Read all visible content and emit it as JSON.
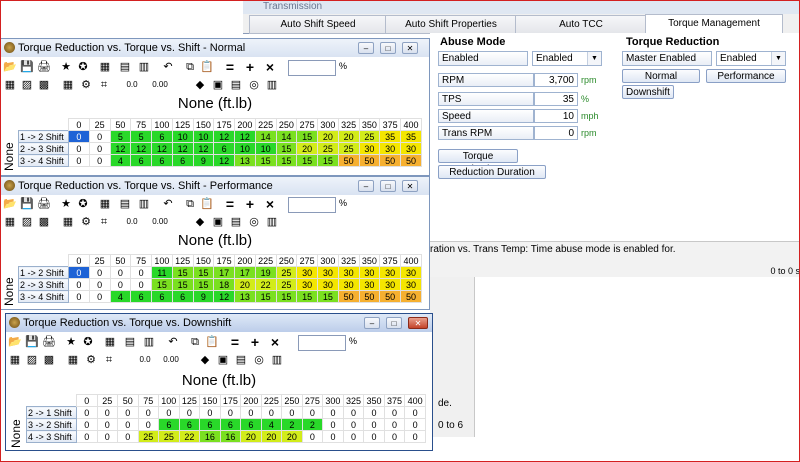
{
  "background": {
    "window_title": "Transmission",
    "tabs": [
      "Auto Shift Speed",
      "Auto Shift Properties",
      "Auto TCC",
      "Torque Management"
    ],
    "active_tab": "Torque Management",
    "abuse": {
      "heading": "Abuse Mode",
      "mode_label": "Enabled",
      "mode_value": "Enabled",
      "fields": [
        {
          "label": "RPM",
          "value": "3,700",
          "unit": "rpm"
        },
        {
          "label": "TPS",
          "value": "35",
          "unit": "%"
        },
        {
          "label": "Speed",
          "value": "10",
          "unit": "mph"
        },
        {
          "label": "Trans RPM",
          "value": "0",
          "unit": "rpm"
        }
      ],
      "btn_torque_reduction": "Torque Reduction",
      "btn_reduction_duration": "Reduction Duration"
    },
    "torque": {
      "heading": "Torque Reduction",
      "master_label": "Master Enabled",
      "master_value": "Enabled",
      "btn_normal": "Normal",
      "btn_performance": "Performance",
      "btn_downshift": "Downshift"
    },
    "status_text": "ration vs. Trans Temp: Time abuse mode is enabled for.",
    "status_right": "0 to 0 s",
    "lower_fragment_1": "de.",
    "lower_fragment_2": "0 to 6"
  },
  "toolbar": {
    "eq": "=",
    "plus": "+",
    "times": "×",
    "pct": "%",
    "dec1": "0.0",
    "dec2": "0.00"
  },
  "windows": [
    {
      "title": "Torque Reduction vs. Torque vs. Shift - Normal",
      "table_title": "None (ft.lb)",
      "axis_label": "None",
      "columns": [
        "0",
        "25",
        "50",
        "75",
        "100",
        "125",
        "150",
        "175",
        "200",
        "225",
        "250",
        "275",
        "300",
        "325",
        "350",
        "375",
        "400"
      ],
      "rows": [
        {
          "label": "1 -> 2 Shift",
          "values": [
            "0",
            "0",
            "5",
            "5",
            "6",
            "10",
            "10",
            "12",
            "12",
            "14",
            "14",
            "15",
            "20",
            "20",
            "25",
            "35",
            "35"
          ]
        },
        {
          "label": "2 -> 3 Shift",
          "values": [
            "0",
            "0",
            "12",
            "12",
            "12",
            "12",
            "12",
            "6",
            "10",
            "10",
            "15",
            "20",
            "25",
            "25",
            "30",
            "30",
            "30"
          ]
        },
        {
          "label": "3 -> 4 Shift",
          "values": [
            "0",
            "0",
            "4",
            "6",
            "6",
            "6",
            "9",
            "12",
            "13",
            "15",
            "15",
            "15",
            "15",
            "50",
            "50",
            "50",
            "50"
          ]
        }
      ]
    },
    {
      "title": "Torque Reduction vs. Torque vs. Shift - Performance",
      "table_title": "None (ft.lb)",
      "axis_label": "None",
      "columns": [
        "0",
        "25",
        "50",
        "75",
        "100",
        "125",
        "150",
        "175",
        "200",
        "225",
        "250",
        "275",
        "300",
        "325",
        "350",
        "375",
        "400"
      ],
      "rows": [
        {
          "label": "1 -> 2 Shift",
          "values": [
            "0",
            "0",
            "0",
            "0",
            "11",
            "15",
            "15",
            "17",
            "17",
            "19",
            "25",
            "30",
            "30",
            "30",
            "30",
            "30",
            "30"
          ]
        },
        {
          "label": "2 -> 3 Shift",
          "values": [
            "0",
            "0",
            "0",
            "0",
            "15",
            "15",
            "15",
            "18",
            "20",
            "22",
            "25",
            "30",
            "30",
            "30",
            "30",
            "30",
            "30"
          ]
        },
        {
          "label": "3 -> 4 Shift",
          "values": [
            "0",
            "0",
            "4",
            "6",
            "6",
            "6",
            "9",
            "12",
            "13",
            "15",
            "15",
            "15",
            "15",
            "50",
            "50",
            "50",
            "50"
          ]
        }
      ]
    },
    {
      "title": "Torque Reduction vs. Torque vs. Downshift",
      "table_title": "None (ft.lb)",
      "axis_label": "None",
      "columns": [
        "0",
        "25",
        "50",
        "75",
        "100",
        "125",
        "150",
        "175",
        "200",
        "225",
        "250",
        "275",
        "300",
        "325",
        "350",
        "375",
        "400"
      ],
      "rows": [
        {
          "label": "2 -> 1 Shift",
          "values": [
            "0",
            "0",
            "0",
            "0",
            "0",
            "0",
            "0",
            "0",
            "0",
            "0",
            "0",
            "0",
            "0",
            "0",
            "0",
            "0",
            "0"
          ]
        },
        {
          "label": "3 -> 2 Shift",
          "values": [
            "0",
            "0",
            "0",
            "0",
            "6",
            "6",
            "6",
            "6",
            "6",
            "4",
            "2",
            "2",
            "0",
            "0",
            "0",
            "0",
            "0"
          ]
        },
        {
          "label": "4 -> 3 Shift",
          "values": [
            "0",
            "0",
            "0",
            "25",
            "25",
            "22",
            "16",
            "16",
            "20",
            "20",
            "20",
            "0",
            "0",
            "0",
            "0",
            "0",
            "0"
          ]
        }
      ]
    }
  ]
}
